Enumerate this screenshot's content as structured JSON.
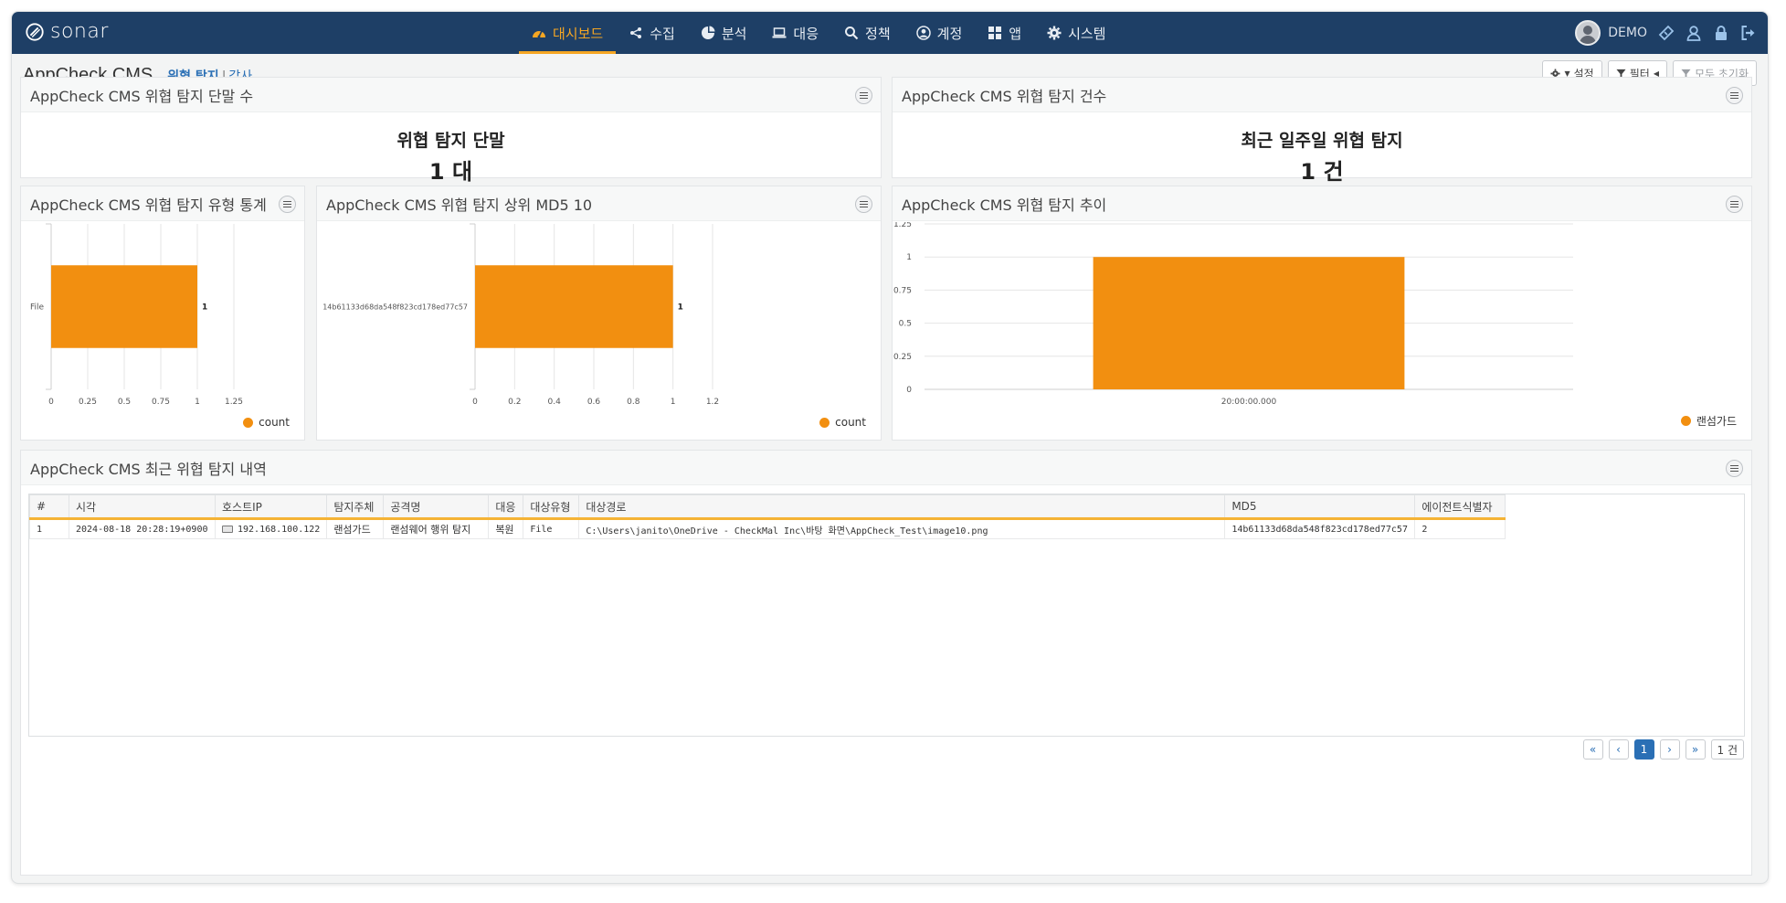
{
  "app": {
    "logo_text": "sonar",
    "user_name": "DEMO"
  },
  "nav": {
    "items": [
      {
        "label": "대시보드",
        "icon": "dashboard-icon",
        "active": true
      },
      {
        "label": "수집",
        "icon": "share-icon"
      },
      {
        "label": "분석",
        "icon": "pie-chart-icon"
      },
      {
        "label": "대응",
        "icon": "laptop-icon"
      },
      {
        "label": "정책",
        "icon": "search-icon"
      },
      {
        "label": "계정",
        "icon": "user-circle-icon"
      },
      {
        "label": "앱",
        "icon": "grid-icon"
      },
      {
        "label": "시스템",
        "icon": "gear-icon"
      }
    ]
  },
  "header": {
    "title": "AppCheck CMS",
    "crumb_active": "위협 탐지",
    "crumb_sep": "|",
    "crumb_other": "감사",
    "settings_label": "설정",
    "filter_label": "필터",
    "reset_label": "모두 초기화"
  },
  "panels": {
    "device_count": {
      "title": "AppCheck CMS 위협 탐지 단말 수",
      "label": "위협 탐지 단말",
      "value": "1 대"
    },
    "detect_count": {
      "title": "AppCheck CMS 위협 탐지 건수",
      "label": "최근 일주일 위협 탐지",
      "value": "1 건"
    },
    "type_stats": {
      "title": "AppCheck CMS 위협 탐지 유형 통계"
    },
    "top_md5": {
      "title": "AppCheck CMS 위협 탐지 상위 MD5 10"
    },
    "trend": {
      "title": "AppCheck CMS 위협 탐지 추이"
    },
    "recent": {
      "title": "AppCheck CMS 최근 위협 탐지 내역"
    }
  },
  "chart_data": [
    {
      "type": "bar",
      "orientation": "horizontal",
      "categories": [
        "File"
      ],
      "series": [
        {
          "name": "count",
          "values": [
            1
          ]
        }
      ],
      "xlim": [
        0,
        1.25
      ],
      "xticks": [
        "0",
        "0.25",
        "0.5",
        "0.75",
        "1",
        "1.25"
      ],
      "legend": "bottom-right",
      "color": "#f28f10",
      "grid": true
    },
    {
      "type": "bar",
      "orientation": "horizontal",
      "categories": [
        "14b61133d68da548f823cd178ed77c57"
      ],
      "series": [
        {
          "name": "count",
          "values": [
            1
          ]
        }
      ],
      "xlim": [
        0,
        1.2
      ],
      "xticks": [
        "0",
        "0.2",
        "0.4",
        "0.6",
        "0.8",
        "1",
        "1.2"
      ],
      "legend": "bottom-right",
      "color": "#f28f10",
      "grid": true
    },
    {
      "type": "bar",
      "categories": [
        "20:00:00.000"
      ],
      "series": [
        {
          "name": "랜섬가드",
          "values": [
            1
          ]
        }
      ],
      "ylim": [
        0,
        1.25
      ],
      "yticks": [
        "0",
        "0.25",
        "0.5",
        "0.75",
        "1",
        "1.25"
      ],
      "legend": "bottom-right",
      "color": "#f28f10",
      "grid": true
    }
  ],
  "table": {
    "columns": [
      "#",
      "시각",
      "호스트IP",
      "탐지주체",
      "공격명",
      "대응",
      "대상유형",
      "대상경로",
      "MD5",
      "에이전트식별자"
    ],
    "rows": [
      [
        "1",
        "2024-08-18 20:28:19+0900",
        "192.168.100.122",
        "랜섬가드",
        "랜섬웨어 행위 탐지",
        "복원",
        "File",
        "C:\\Users\\janito\\OneDrive - CheckMal Inc\\바탕 화면\\AppCheck_Test\\image10.png",
        "14b61133d68da548f823cd178ed77c57",
        "2"
      ]
    ]
  },
  "pager": {
    "first": "«",
    "prev": "‹",
    "current": "1",
    "next": "›",
    "last": "»",
    "total": "1 건"
  }
}
